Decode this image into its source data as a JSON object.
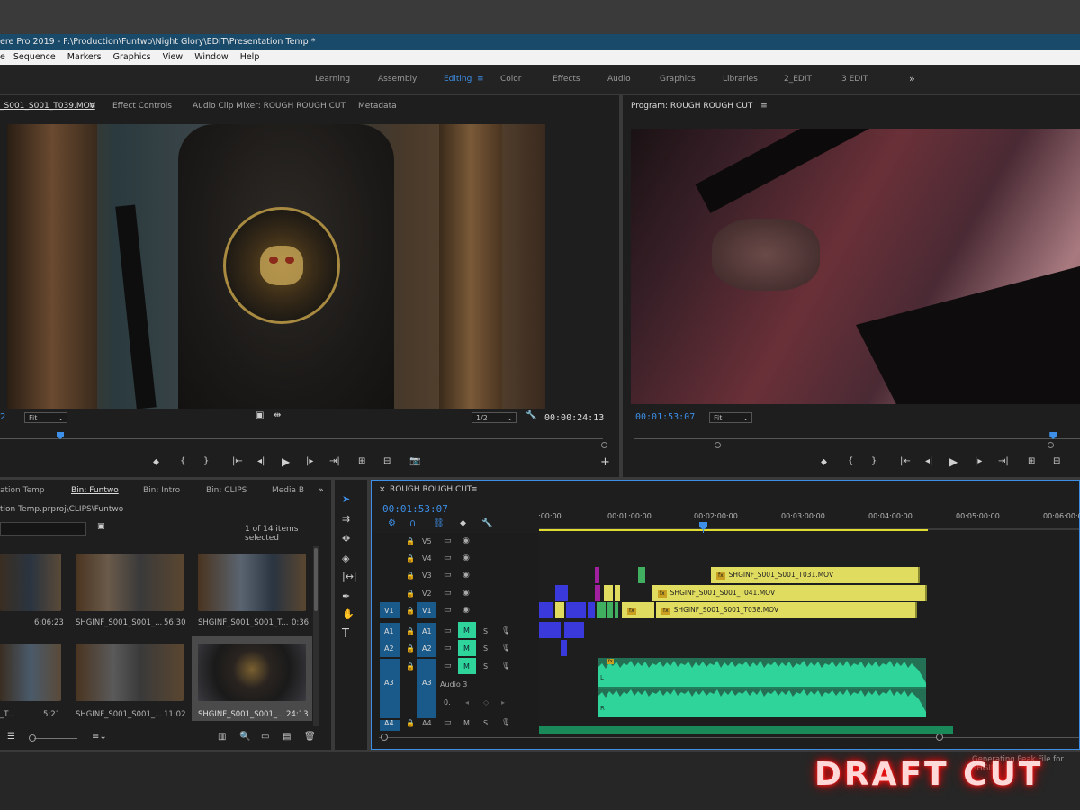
{
  "app": {
    "title": "ere Pro 2019 - F:\\Production\\Funtwo\\Night Glory\\EDIT\\Presentation Temp *"
  },
  "menu": [
    "e",
    "Sequence",
    "Markers",
    "Graphics",
    "View",
    "Window",
    "Help"
  ],
  "workspaces": [
    {
      "label": "Learning",
      "active": false
    },
    {
      "label": "Assembly",
      "active": false
    },
    {
      "label": "Editing",
      "active": true
    },
    {
      "label": "Color",
      "active": false
    },
    {
      "label": "Effects",
      "active": false
    },
    {
      "label": "Audio",
      "active": false
    },
    {
      "label": "Graphics",
      "active": false
    },
    {
      "label": "Libraries",
      "active": false
    },
    {
      "label": "2_EDIT",
      "active": false
    },
    {
      "label": "3 EDIT",
      "active": false
    }
  ],
  "workspaces_more": "»",
  "source": {
    "tabs": [
      "_S001_S001_T039.MOV",
      "Effect Controls",
      "Audio Clip Mixer: ROUGH ROUGH CUT",
      "Metadata"
    ],
    "menu_icon": "≡",
    "fit": "Fit",
    "left_num": "2",
    "resolution": "1/2",
    "timecode": "00:00:24:13",
    "playhead_fraction": 0.1
  },
  "program": {
    "tab": "Program: ROUGH ROUGH CUT",
    "menu_icon": "≡",
    "timecode": "00:01:53:07",
    "fit": "Fit",
    "playhead_fraction": 0.94
  },
  "project": {
    "tabs": [
      "ation Temp",
      "Bin: Funtwo",
      "Bin: Intro",
      "Bin: CLIPS",
      "Media B"
    ],
    "active_tab": 1,
    "more": "»",
    "path": "tion Temp.prproj\\CLIPS\\Funtwo",
    "count": "1 of 14 items selected",
    "items": [
      {
        "name": "",
        "duration": "6:06:23"
      },
      {
        "name": "SHGINF_S001_S001_...",
        "duration": "56:30"
      },
      {
        "name": "SHGINF_S001_S001_T...",
        "duration": "0:36"
      },
      {
        "name": "_T...",
        "duration": "5:21"
      },
      {
        "name": "SHGINF_S001_S001_...",
        "duration": "11:02"
      },
      {
        "name": "SHGINF_S001_S001_...",
        "duration": "24:13"
      }
    ]
  },
  "timeline": {
    "close": "×",
    "title": "ROUGH ROUGH CUT",
    "menu_icon": "≡",
    "timecode": "00:01:53:07",
    "ruler": [
      ":00:00",
      "00:01:00:00",
      "00:02:00:00",
      "00:03:00:00",
      "00:04:00:00",
      "00:05:00:00",
      "00:06:00:0"
    ],
    "video_tracks": [
      "V5",
      "V4",
      "V3",
      "V2",
      "V1"
    ],
    "source_patch_v": "V1",
    "audio_tracks": [
      "A1",
      "A2",
      "A3",
      "A4"
    ],
    "source_patch_a": [
      "A1",
      "A2",
      "A3",
      "A4"
    ],
    "mute": "M",
    "solo": "S",
    "audio3_name": "Audio 3",
    "audio3_vol": "0.",
    "channel_l": "L",
    "channel_r": "R",
    "clips": [
      {
        "track": "V3",
        "label": "SHGINF_S001_S001_T031.MOV"
      },
      {
        "track": "V2",
        "label": "SHGINF_S001_S001_T041.MOV"
      },
      {
        "track": "V1",
        "label": "SHGINF_S001_S001_T038.MOV"
      }
    ],
    "fx_label": "fx"
  },
  "status": {
    "text": "Generating Peak File for SHGIN"
  },
  "watermark": "DRAFT CUT",
  "colors": {
    "accent": "#3d8fe8",
    "clip_video": "#e0dc60",
    "clip_audio": "#2ed49a",
    "title_bar": "#1a4a6a"
  }
}
